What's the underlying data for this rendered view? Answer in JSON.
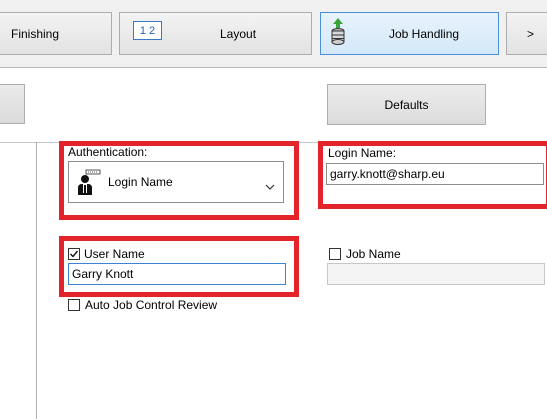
{
  "tabs": {
    "finishing": "Finishing",
    "layout_icon_text": "1 2",
    "layout": "Layout",
    "job_handling": "Job Handling",
    "more": ">"
  },
  "defaults_button": "Defaults",
  "authentication": {
    "label": "Authentication:",
    "selected": "Login Name",
    "icon": "user-login-icon"
  },
  "login_name": {
    "label": "Login Name:",
    "value": "garry.knott@sharp.eu"
  },
  "user_name": {
    "label": "User Name",
    "checked": true,
    "value": "Garry Knott"
  },
  "job_name": {
    "label": "Job Name",
    "checked": false,
    "value": ""
  },
  "auto_job_control_review": {
    "label": "Auto Job Control Review",
    "checked": false
  },
  "colors": {
    "highlight_red": "#e3242b",
    "active_tab_border": "#4a90d9",
    "focus_border": "#3d84d4"
  }
}
